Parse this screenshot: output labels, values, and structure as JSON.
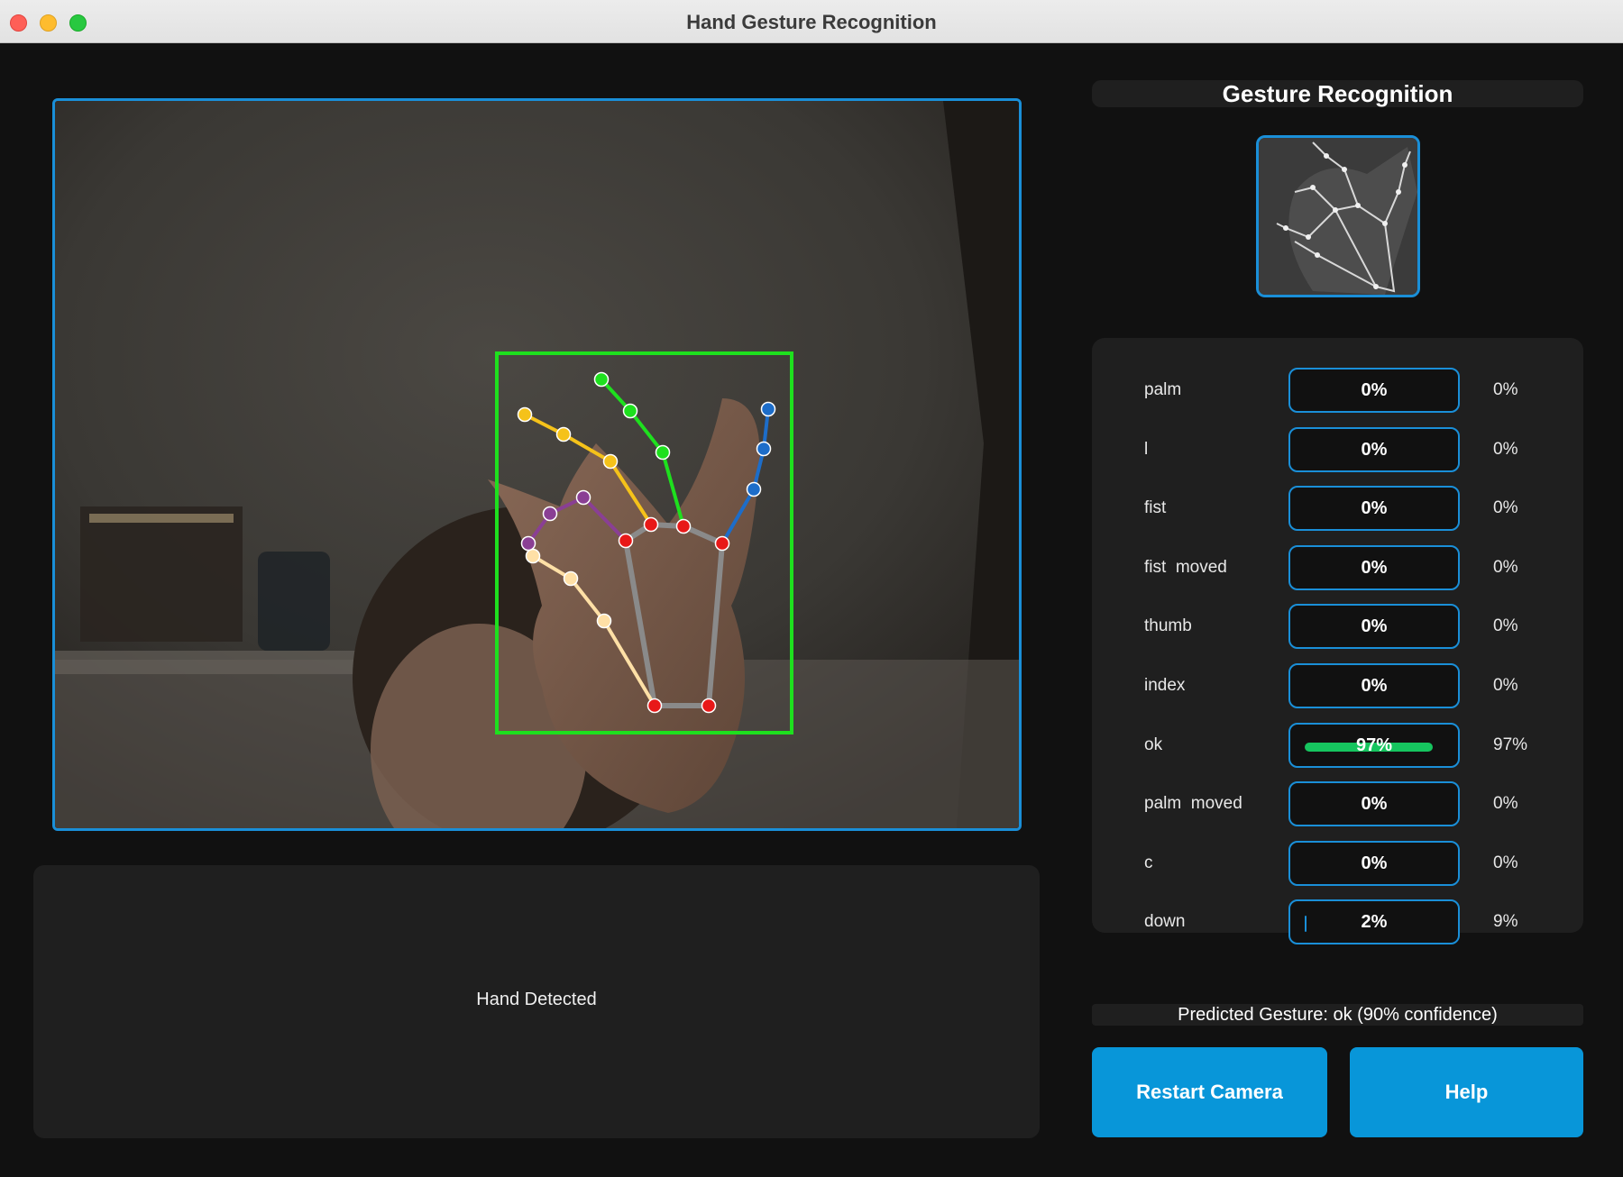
{
  "window": {
    "title": "Hand Gesture Recognition"
  },
  "camera": {
    "status_text": "Hand Detected"
  },
  "side": {
    "title": "Gesture Recognition"
  },
  "scores": [
    {
      "label": "palm",
      "bar_text": "0%",
      "fill": 0,
      "raw": "0%"
    },
    {
      "label": "l",
      "bar_text": "0%",
      "fill": 0,
      "raw": "0%"
    },
    {
      "label": "fist",
      "bar_text": "0%",
      "fill": 0,
      "raw": "0%"
    },
    {
      "label": "fist  moved",
      "bar_text": "0%",
      "fill": 0,
      "raw": "0%"
    },
    {
      "label": "thumb",
      "bar_text": "0%",
      "fill": 0,
      "raw": "0%"
    },
    {
      "label": "index",
      "bar_text": "0%",
      "fill": 0,
      "raw": "0%"
    },
    {
      "label": "ok",
      "bar_text": "97%",
      "fill": 0.97,
      "raw": "97%"
    },
    {
      "label": "palm  moved",
      "bar_text": "0%",
      "fill": 0,
      "raw": "0%"
    },
    {
      "label": "c",
      "bar_text": "0%",
      "fill": 0,
      "raw": "0%"
    },
    {
      "label": "down",
      "bar_text": "2%",
      "fill": 0.02,
      "raw": "9%"
    }
  ],
  "prediction": {
    "text": "Predicted Gesture: ok (90% confidence)"
  },
  "buttons": {
    "restart": "Restart Camera",
    "help": "Help"
  },
  "colors": {
    "accent": "#1a8fd8",
    "button": "#0896d9",
    "fill": "#16c55f",
    "detection_box": "#1ee01e"
  }
}
